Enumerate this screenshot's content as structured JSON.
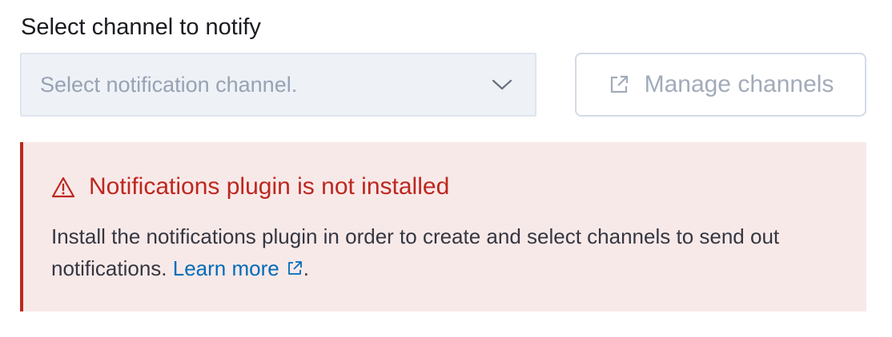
{
  "form": {
    "label": "Select channel to notify",
    "select": {
      "placeholder": "Select notification channel.",
      "icon": "chevron-down-icon"
    },
    "manage_button": {
      "label": "Manage channels",
      "icon": "external-link-icon"
    }
  },
  "callout": {
    "icon": "warning-icon",
    "title": "Notifications plugin is not installed",
    "body_text": "Install the notifications plugin in order to create and select channels to send out notifications.",
    "link_label": "Learn more",
    "link_icon": "external-link-icon",
    "trailing": "."
  },
  "colors": {
    "danger": "#bd271e",
    "link": "#006bb8",
    "callout_bg": "#f8e9e9",
    "disabled_bg": "#eef2f7",
    "disabled_text": "#98a2b3"
  }
}
